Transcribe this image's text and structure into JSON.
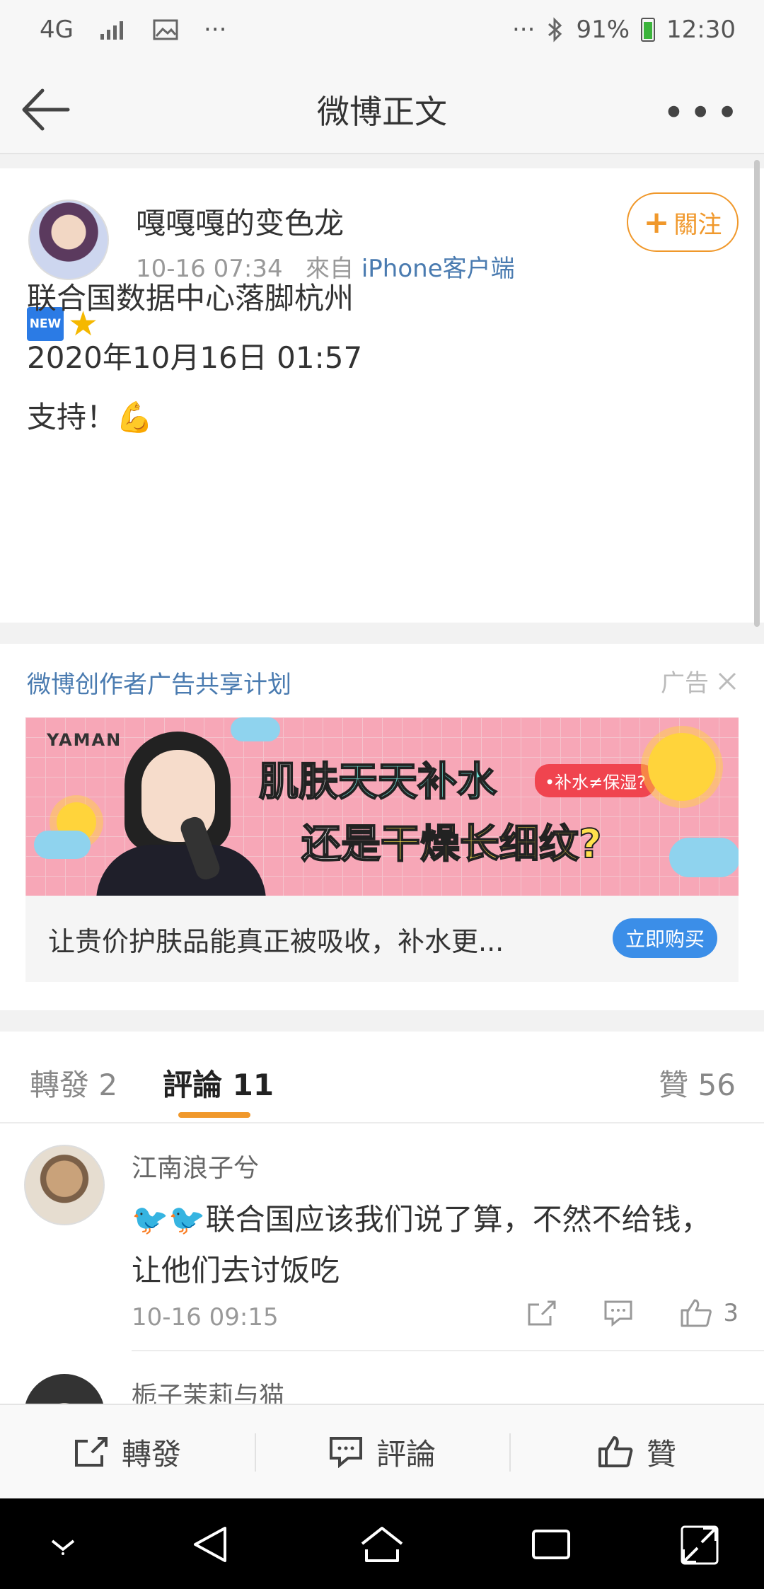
{
  "status_bar": {
    "network": "4G",
    "battery": "91%",
    "time": "12:30",
    "more_left": "···",
    "more_right": "···"
  },
  "nav": {
    "title": "微博正文",
    "more": "•••"
  },
  "post": {
    "author": "嘎嘎嘎的变色龙",
    "time": "10-16 07:34",
    "from_label": "來自",
    "source": "iPhone客户端",
    "follow_plus": "+",
    "follow_label": "關注",
    "badge_new": "NEW",
    "line1": "联合国数据中心落脚杭州",
    "line2": "2020年10月16日 01:57",
    "line3": "支持！💪"
  },
  "ad": {
    "header": "微博创作者广告共享计划",
    "tag": "广告",
    "brand": "YAMAN",
    "headline1_a": "肌肤",
    "headline1_b": "天天补水",
    "headline2_a": "还是",
    "headline2_b": "干燥长细纹?",
    "pill": "•补水≠保湿?",
    "text": "让贵价护肤品能真正被吸收，补水更...",
    "button": "立即购买"
  },
  "tabs": {
    "repost": "轉發 2",
    "comments": "評論 11",
    "likes": "贊 56"
  },
  "comments": [
    {
      "name": "江南浪子兮",
      "birds": "🐦🐦",
      "text": "联合国应该我们说了算，不然不给钱，让他们去讨饭吃",
      "time": "10-16 09:15",
      "like_count": "3"
    },
    {
      "name": "栀子茉莉与猫"
    }
  ],
  "actionbar": {
    "repost": "轉發",
    "comment": "評論",
    "like": "贊"
  },
  "colors": {
    "accent": "#f0982b",
    "link": "#4a7bb0",
    "button_blue": "#3b8ee8"
  }
}
